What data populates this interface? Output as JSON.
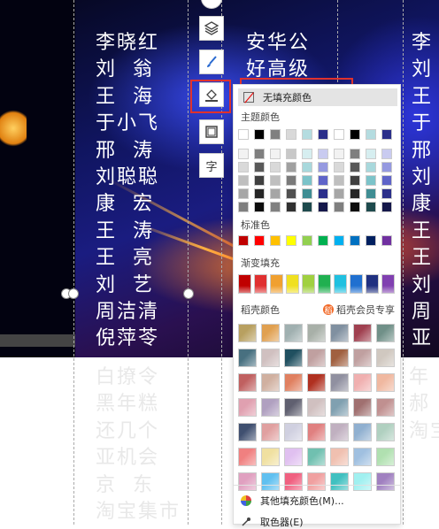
{
  "slide": {
    "col1": [
      "李晓红",
      "刘  翁",
      "王  海",
      "于小飞",
      "邢  涛",
      "刘聪聪",
      "康  宏",
      "王  涛",
      "王  亮",
      "刘  艺",
      "周洁清",
      "倪萍苓"
    ],
    "col1_faded": [
      "白撩令",
      "黑年糕",
      "还几个",
      "亚机会",
      "京  东",
      "淘宝集市"
    ],
    "col2": [
      "安华公",
      "好高级"
    ],
    "col3": [
      "李",
      "刘",
      "王",
      "于",
      "邢",
      "刘",
      "康",
      "王",
      "王",
      "刘",
      "周",
      "亚"
    ],
    "col3_faded": [
      "年",
      "郝",
      "淘宝"
    ]
  },
  "toolbar": {
    "icons": [
      "layers-icon",
      "brush-icon",
      "fill-bucket-icon",
      "border-icon",
      "text-style-icon"
    ],
    "text_style_glyph": "字"
  },
  "panel": {
    "no_fill": "无填充颜色",
    "theme_colors_label": "主题颜色",
    "standard_colors_label": "标准色",
    "gradient_fill_label": "渐变填充",
    "daoke_colors_label": "稻壳颜色",
    "member_label": "稻壳会员专享",
    "member_badge": "稻",
    "more_fill": "其他填充颜色(M)...",
    "eyedropper": "取色器(E)",
    "theme_top": [
      "#ffffff",
      "#000000",
      "#808080",
      "#d9d9d9",
      "#b4dce0",
      "#2b2f8a",
      "#ffffff",
      "#000000",
      "#b4dce0",
      "#2b2f8a"
    ],
    "theme_cols": [
      [
        "#f2f2f2",
        "#d9d9d9",
        "#bfbfbf",
        "#a6a6a6",
        "#7f7f7f"
      ],
      [
        "#7f7f7f",
        "#595959",
        "#404040",
        "#262626",
        "#0d0d0d"
      ],
      [
        "#f2f2f2",
        "#d9d9d9",
        "#bfbfbf",
        "#a6a6a6",
        "#808080"
      ],
      [
        "#c8c8c8",
        "#a0a0a0",
        "#7a7a7a",
        "#505050",
        "#303030"
      ],
      [
        "#d6eef0",
        "#a8d8dc",
        "#7cc3c9",
        "#3f8d93",
        "#1e4a4d"
      ],
      [
        "#c9cbf0",
        "#9599e0",
        "#5f64c8",
        "#2b2f8a",
        "#15184a"
      ],
      [
        "#f2f2f2",
        "#d9d9d9",
        "#bfbfbf",
        "#a6a6a6",
        "#7f7f7f"
      ],
      [
        "#7f7f7f",
        "#595959",
        "#404040",
        "#262626",
        "#0d0d0d"
      ],
      [
        "#d6eef0",
        "#a8d8dc",
        "#7cc3c9",
        "#3f8d93",
        "#1e4a4d"
      ],
      [
        "#c9cbf0",
        "#9599e0",
        "#5f64c8",
        "#2b2f8a",
        "#15184a"
      ]
    ],
    "standard": [
      "#c00000",
      "#ff0000",
      "#ffc000",
      "#ffff00",
      "#92d050",
      "#00b050",
      "#00b0f0",
      "#0070c0",
      "#002060",
      "#7030a0"
    ],
    "gradient": [
      "#c00000",
      "#e03030",
      "#f0a030",
      "#f0e020",
      "#a0d040",
      "#20b050",
      "#20c0e0",
      "#2070d0",
      "#203080",
      "#8040b0"
    ],
    "daoke": [
      [
        "#b8a060",
        "#e0a050",
        "#a0b0b0",
        "#a8b0a8",
        "#8090a0",
        "#a04050",
        "#709088"
      ],
      [
        "#487080",
        "#d0c0c0",
        "#205060",
        "#c0a0a0",
        "#a06040",
        "#c0a0a0",
        "#d0c8c0"
      ],
      [
        "#c06060",
        "#d0b0a0",
        "#e08060",
        "#b03020",
        "#9090a0",
        "#f0b0b0",
        "#f0b8a0"
      ],
      [
        "#e0a0b0",
        "#b0a0c0",
        "#606070",
        "#d0c0c0",
        "#80a0b0",
        "#a07070",
        "#c09090"
      ],
      [
        "#405070",
        "#e0a0a0",
        "#d0d0e0",
        "#e08080",
        "#c0b0c0",
        "#90b0d0",
        "#b0d0c0"
      ],
      [
        "#f08080",
        "#f0e0a0",
        "#e0c0f0",
        "#70c0b0",
        "#f0c0b0",
        "#a0c0e0",
        "#b0e0b0"
      ],
      [
        "#e0a0c0",
        "#60c0f0",
        "#f06080",
        "#f0a0a0",
        "#40c0c0",
        "#a0f0f0",
        "#a080c0"
      ]
    ],
    "colors": {
      "accent": "#e0322d",
      "member_orange": "#f26b2a"
    }
  }
}
